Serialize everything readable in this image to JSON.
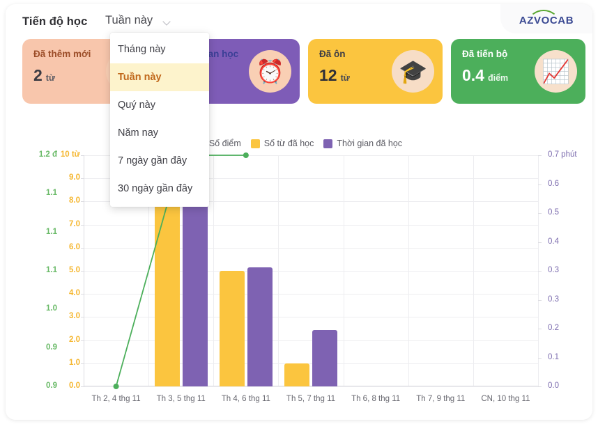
{
  "header": {
    "title": "Tiến độ học",
    "selected_period": "Tuần này",
    "chevron_icon": "chevron-down-icon",
    "brand": "AZVOCAB"
  },
  "dropdown": {
    "options": [
      {
        "label": "Tháng này",
        "active": false
      },
      {
        "label": "Tuần này",
        "active": true
      },
      {
        "label": "Quý này",
        "active": false
      },
      {
        "label": "Năm nay",
        "active": false
      },
      {
        "label": "7 ngày gần đây",
        "active": false
      },
      {
        "label": "30 ngày gần đây",
        "active": false
      }
    ]
  },
  "cards": [
    {
      "label": "Đã thêm mới",
      "value": "2",
      "unit": "từ",
      "theme": "peach",
      "emoji": "📚",
      "icon": "books-icon"
    },
    {
      "label": "Thời gian học",
      "value": "",
      "unit": "",
      "theme": "purple",
      "emoji": "⏰",
      "icon": "alarm-clock-icon"
    },
    {
      "label": "Đã ôn",
      "value": "12",
      "unit": "từ",
      "theme": "yellow",
      "emoji": "🎓",
      "icon": "graduation-cap-icon"
    },
    {
      "label": "Đã tiến bộ",
      "value": "0.4",
      "unit": "điểm",
      "theme": "green",
      "emoji": "📈",
      "icon": "growth-chart-icon"
    }
  ],
  "colors": {
    "score_green": "#4caf5b",
    "words_yellow": "#fbc53f",
    "time_purple": "#7e62b2",
    "axis_green": "#6aba68",
    "axis_yellow": "#f5b731",
    "axis_purple": "#7b6bae"
  },
  "chart_data": {
    "type": "bar",
    "title": "",
    "xlabel": "",
    "grid": true,
    "legend_position": "top-center",
    "categories": [
      "Th 2, 4 thg 11",
      "Th 3, 5 thg 11",
      "Th 4, 6 thg 11",
      "Th 5, 7 thg 11",
      "Th 6, 8 thg 11",
      "Th 7, 9 thg 11",
      "CN, 10 thg 11"
    ],
    "series": [
      {
        "name": "Số điểm",
        "type": "line",
        "color": "#4caf5b",
        "axis": "left-green",
        "values": [
          0.9,
          1.2,
          1.2,
          null,
          null,
          null,
          null
        ],
        "ylabel": "đ",
        "ylim": [
          0.9,
          1.2
        ],
        "tick_labels": [
          "1.2 đ",
          "1.1",
          "1.1",
          "1.1",
          "1.0",
          "0.9",
          "0.9"
        ]
      },
      {
        "name": "Số từ đã học",
        "type": "bar",
        "color": "#fbc53f",
        "axis": "left-yellow",
        "values": [
          0,
          8.0,
          5.0,
          1.0,
          0,
          0,
          0
        ],
        "ylabel": "từ",
        "ylim": [
          0,
          10
        ],
        "tick_labels": [
          "10 từ",
          "9.0",
          "8.0",
          "7.0",
          "6.0",
          "5.0",
          "4.0",
          "3.0",
          "2.0",
          "1.0",
          "0.0"
        ]
      },
      {
        "name": "Thời gian đã học",
        "type": "bar",
        "color": "#7e62b2",
        "axis": "right",
        "values": [
          0,
          0.56,
          0.36,
          0.17,
          0,
          0,
          0
        ],
        "ylabel": "phút",
        "ylim": [
          0,
          0.7
        ],
        "tick_labels": [
          "0.7 phút",
          "0.6",
          "0.5",
          "0.4",
          "0.3",
          "0.3",
          "0.2",
          "0.1",
          "0.0"
        ]
      }
    ]
  }
}
